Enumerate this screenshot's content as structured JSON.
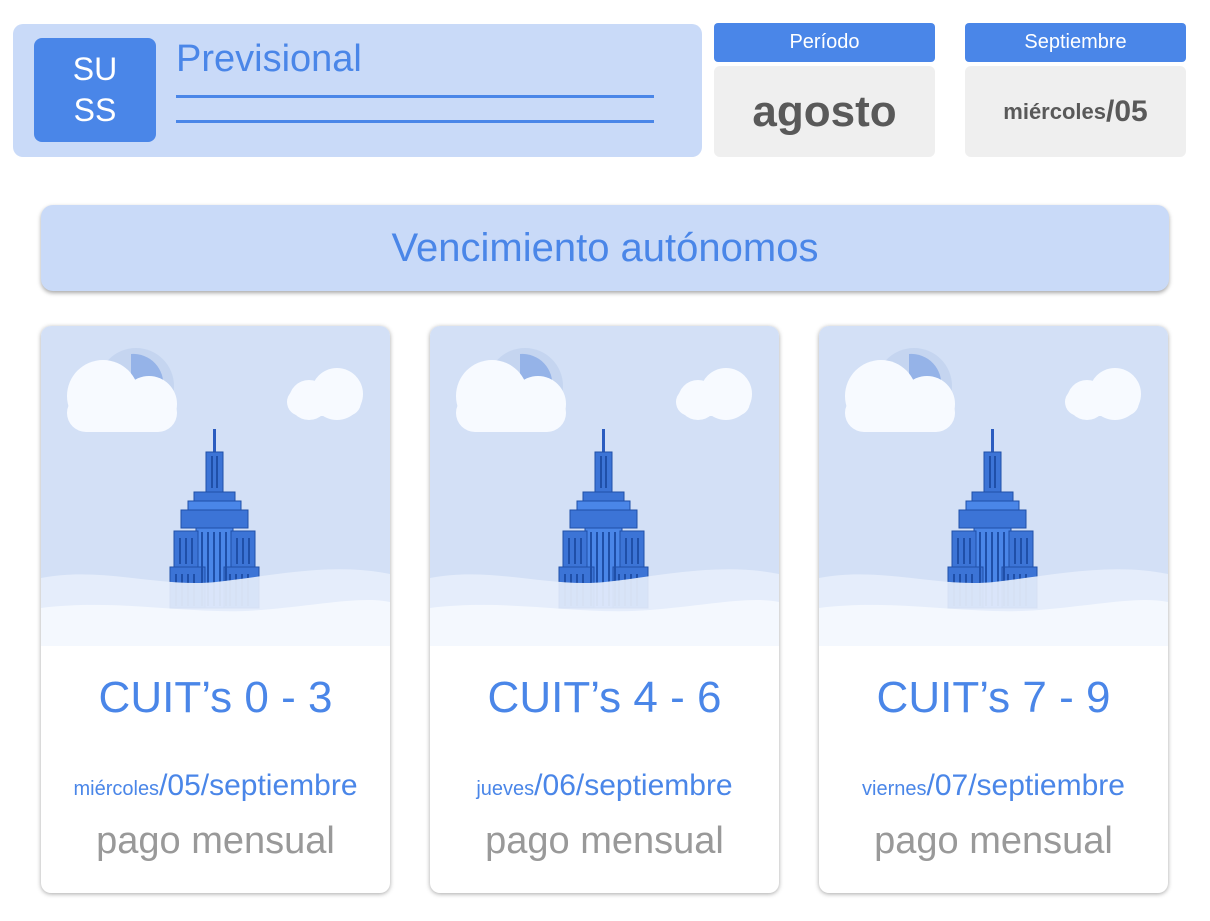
{
  "header": {
    "logo_line1": "SU",
    "logo_line2": "SS",
    "title": "Previsional"
  },
  "period": {
    "label": "Período",
    "value": "agosto"
  },
  "due": {
    "label": "Septiembre",
    "weekday": "miércoles",
    "day": "/05"
  },
  "banner": {
    "title": "Vencimiento autónomos"
  },
  "cards": [
    {
      "title": "CUIT’s 0 - 3",
      "weekday": "miércoles",
      "date_rest": "/05/septiembre",
      "subtitle": "pago mensual"
    },
    {
      "title": "CUIT’s 4 - 6",
      "weekday": "jueves",
      "date_rest": "/06/septiembre",
      "subtitle": "pago mensual"
    },
    {
      "title": "CUIT’s 7 - 9",
      "weekday": "viernes",
      "date_rest": "/07/septiembre",
      "subtitle": "pago mensual"
    }
  ],
  "colors": {
    "accent": "#4a86e8",
    "light_accent": "#c9daf8",
    "tile_gray": "#efefef",
    "text_gray": "#999999"
  },
  "icons": {
    "illustration": "building-cloud-illustration"
  }
}
